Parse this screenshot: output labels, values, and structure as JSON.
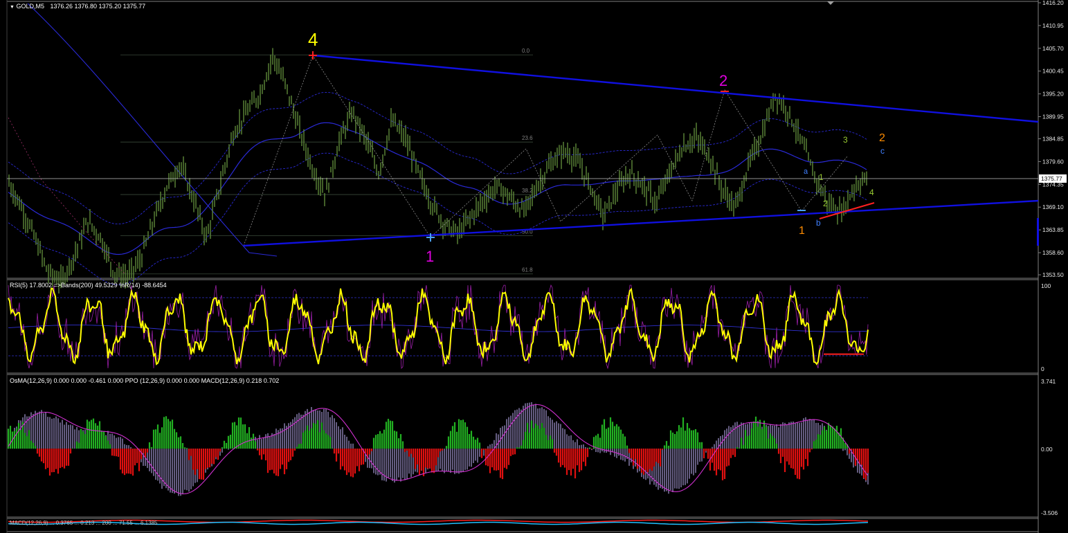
{
  "header": {
    "symbol": "GOLD,M5",
    "ohlc": "1376.26 1376.80 1375.20 1375.77",
    "rsi_caption": "RSI(5) 17.8002  =>Bands(200) 49.5329  %R(14) -88.6454",
    "osma_caption": "OsMA(12,26,9) 0.000 0.000 -0.461 0.000  PPO (12,26,9) 0.000 0.000  MACD(12,26,9) 0.218 0.702",
    "bottom_caption": "MACD(12,26,9) ... 0.3765 ... 0.213 ... 200 ... 71.55 ... 6.1385"
  },
  "colors": {
    "background": "#000000",
    "candles": "#5e8a3a",
    "trendline": "#1010e0",
    "ma_band": "#2a2ad8",
    "rsi": "#ffff00",
    "wpr": "#9b1fa8",
    "osma_up": "#22b022",
    "osma_down": "#e01010",
    "macd_hist": "#c8b8ff",
    "signal": "#d030d0",
    "bid_line": "#c0c0c0"
  },
  "chart_data": [
    {
      "type": "line",
      "title": "GOLD,M5",
      "y_ticks": [
        "1416.20",
        "1410.95",
        "1405.70",
        "1400.45",
        "1395.20",
        "1389.95",
        "1384.85",
        "1379.60",
        "1374.35",
        "1369.10",
        "1363.85",
        "1358.60",
        "1353.50"
      ],
      "ylim": [
        1353.5,
        1416.2
      ],
      "current_price": "1375.77",
      "x": [
        0,
        3,
        6,
        9,
        12,
        15,
        18,
        21,
        24,
        27,
        30,
        33,
        36,
        39,
        42,
        45,
        48,
        51,
        54,
        57,
        60,
        63,
        66,
        69,
        72,
        75,
        78,
        81,
        84,
        87,
        90,
        93,
        96,
        99,
        102,
        105,
        108,
        111,
        114,
        117,
        120,
        123,
        126,
        129,
        132,
        135,
        138,
        141,
        144,
        147,
        150,
        153,
        156,
        159,
        162,
        165,
        168,
        171,
        174,
        177,
        180,
        183,
        186,
        189,
        192,
        195
      ],
      "price": [
        1375,
        1369,
        1362,
        1354,
        1352,
        1358,
        1366,
        1362,
        1354,
        1353,
        1357,
        1366,
        1374,
        1379,
        1371,
        1362,
        1374,
        1386,
        1391,
        1395,
        1404,
        1397,
        1387,
        1378,
        1372,
        1384,
        1391,
        1385,
        1377,
        1389,
        1385,
        1377,
        1370,
        1365,
        1363,
        1367,
        1371,
        1374,
        1371,
        1368,
        1374,
        1379,
        1382,
        1380,
        1374,
        1367,
        1373,
        1377,
        1374,
        1370,
        1377,
        1383,
        1385,
        1381,
        1373,
        1369,
        1379,
        1386,
        1395,
        1391,
        1384,
        1376,
        1370,
        1368,
        1374,
        1376
      ],
      "waves": [
        {
          "label": "4",
          "color": "#ffff00"
        },
        {
          "label": "1",
          "color": "#e000e0"
        },
        {
          "label": "2",
          "color": "#e000e0"
        },
        {
          "label": "a",
          "color": "#4080ff"
        },
        {
          "label": "b",
          "color": "#4080ff"
        },
        {
          "label": "c",
          "color": "#4080ff"
        },
        {
          "label": "1",
          "color": "#ff8c00"
        },
        {
          "label": "2",
          "color": "#ff8c00"
        },
        {
          "label": "1",
          "color": "#9acd32"
        },
        {
          "label": "2",
          "color": "#9acd32"
        },
        {
          "label": "3",
          "color": "#9acd32"
        },
        {
          "label": "4",
          "color": "#9acd32"
        }
      ],
      "fib_levels": [
        "0.0",
        "23.6",
        "38.2",
        "50.0",
        "61.8"
      ]
    },
    {
      "type": "line",
      "title": "RSI(5)",
      "ylim": [
        0,
        100
      ],
      "y_ticks": [
        "100",
        "0"
      ]
    },
    {
      "type": "bar",
      "title": "OsMA(12,26,9)",
      "y_ticks": [
        "3.741",
        "0.00",
        "-3.506"
      ],
      "ylim": [
        -3.506,
        3.741
      ]
    }
  ]
}
